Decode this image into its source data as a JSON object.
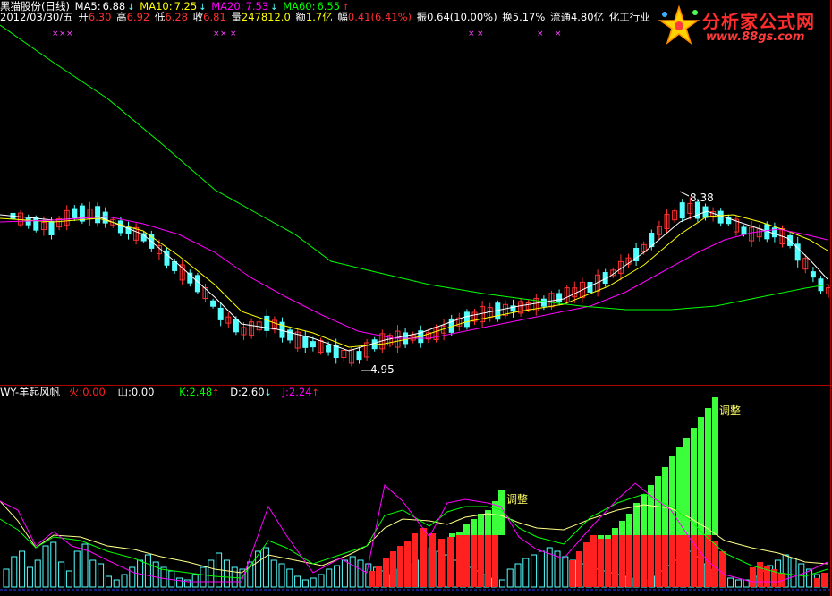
{
  "header": {
    "stock": "黑猫股份(日线)",
    "ma5_label": "MA5:",
    "ma5_value": "6.88",
    "ma10_label": "MA10:",
    "ma10_value": "7.25",
    "ma20_label": "MA20:",
    "ma20_value": "7.53",
    "ma60_label": "MA60:",
    "ma60_value": "6.55",
    "arrow_down": "↓",
    "arrow_up": "↑"
  },
  "info": {
    "date": "2012/03/30/五",
    "open_label": "开",
    "open": "6.30",
    "high_label": "高",
    "high": "6.92",
    "low_label": "低",
    "low": "6.28",
    "close_label": "收",
    "close": "6.81",
    "volume_label": "量",
    "volume": "247812.0",
    "amount_label": "额",
    "amount": "1.7亿",
    "change_label": "幅",
    "change": "0.41(6.41%)",
    "amplitude_label": "振",
    "amplitude": "0.64(10.00%)",
    "turnover_label": "换",
    "turnover": "5.17%",
    "float_label": "流通",
    "float": "4.80亿",
    "industry": "化工行业"
  },
  "indicator": {
    "name": "WY-羊起风帆",
    "fire_label": "火:",
    "fire": "0.00",
    "mountain_label": "山:",
    "mountain": "0.00",
    "k_label": "K:",
    "k": "2.48",
    "d_label": "D:",
    "d": "2.60",
    "j_label": "J:",
    "j": "2.24"
  },
  "annotations": {
    "high_price": "8.38",
    "low_price": "4.95",
    "adjust1": "调整",
    "adjust2": "调整"
  },
  "logo": {
    "name": "分析家公式网",
    "url": "www.88gs.com"
  },
  "colors": {
    "up": "#ff3232",
    "down": "#54ffff",
    "ma5": "#ffffff",
    "ma10": "#ffff00",
    "ma20": "#ff00ff",
    "ma60": "#00ff00",
    "fire": "#ff2020",
    "mountain": "#3cff3c",
    "k": "#00ff00",
    "d": "#ffffff",
    "j": "#ff00ff"
  }
}
